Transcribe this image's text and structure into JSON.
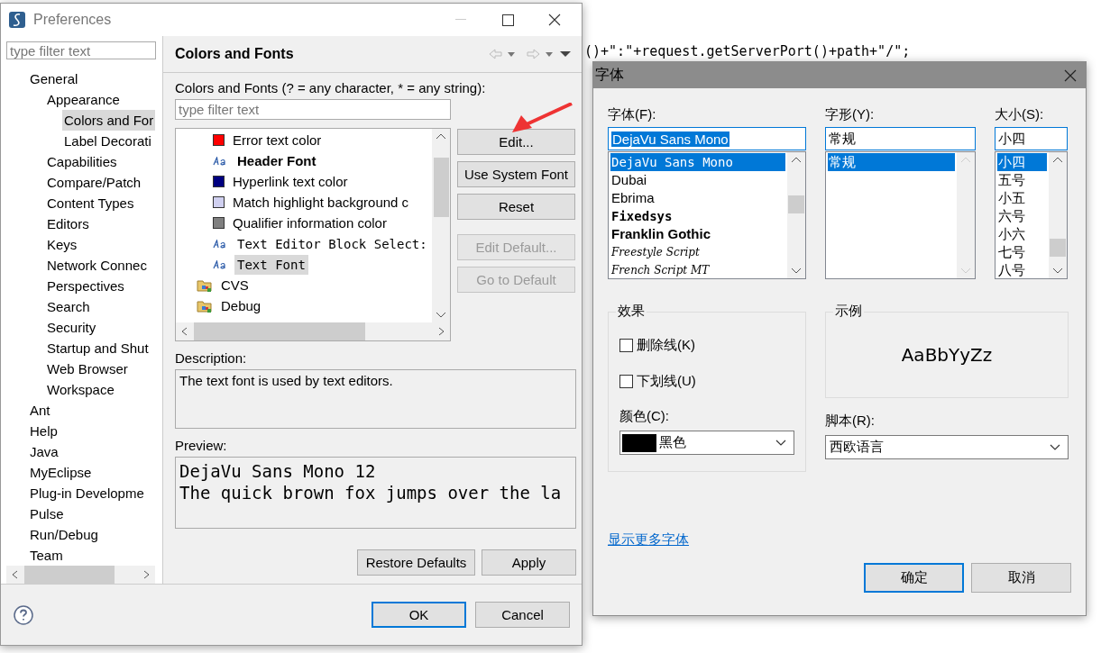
{
  "background_editor": {
    "code_line": "()+\":\"+request.getServerPort()+path+\"/\";"
  },
  "preferences": {
    "title": "Preferences",
    "filter_placeholder": "type filter text",
    "nav": [
      {
        "label": "General",
        "selected": false,
        "children": [
          {
            "label": "Appearance",
            "selected": false,
            "children": [
              {
                "label": "Colors and For",
                "selected": true
              },
              {
                "label": "Label Decorati",
                "selected": false
              }
            ]
          },
          {
            "label": "Capabilities",
            "selected": false
          },
          {
            "label": "Compare/Patch",
            "selected": false
          },
          {
            "label": "Content Types",
            "selected": false
          },
          {
            "label": "Editors",
            "selected": false
          },
          {
            "label": "Keys",
            "selected": false
          },
          {
            "label": "Network Connec",
            "selected": false
          },
          {
            "label": "Perspectives",
            "selected": false
          },
          {
            "label": "Search",
            "selected": false
          },
          {
            "label": "Security",
            "selected": false
          },
          {
            "label": "Startup and Shut",
            "selected": false
          },
          {
            "label": "Web Browser",
            "selected": false
          },
          {
            "label": "Workspace",
            "selected": false
          }
        ]
      },
      {
        "label": "Ant",
        "selected": false
      },
      {
        "label": "Help",
        "selected": false
      },
      {
        "label": "Java",
        "selected": false
      },
      {
        "label": "MyEclipse",
        "selected": false
      },
      {
        "label": "Plug-in Developme",
        "selected": false
      },
      {
        "label": "Pulse",
        "selected": false
      },
      {
        "label": "Run/Debug",
        "selected": false
      },
      {
        "label": "Team",
        "selected": false
      }
    ],
    "page": {
      "title": "Colors and Fonts",
      "filter_label": "Colors and Fonts (? = any character, * = any string):",
      "filter_placeholder": "type filter text",
      "items": [
        {
          "kind": "color",
          "label": "Error text color",
          "color": "#ff0000",
          "selected": false
        },
        {
          "kind": "bold-font",
          "label": "Header Font",
          "selected": false
        },
        {
          "kind": "color",
          "label": "Hyperlink text color",
          "color": "#000080",
          "selected": false
        },
        {
          "kind": "color",
          "label": "Match highlight background c",
          "color": "#d0d0f0",
          "selected": false
        },
        {
          "kind": "color",
          "label": "Qualifier information color",
          "color": "#808080",
          "selected": false
        },
        {
          "kind": "mono-font",
          "label": "Text Editor Block Select:",
          "selected": false
        },
        {
          "kind": "mono-font",
          "label": "Text Font",
          "selected": true
        },
        {
          "kind": "folder",
          "label": "CVS",
          "selected": false
        },
        {
          "kind": "folder",
          "label": "Debug",
          "selected": false
        }
      ],
      "buttons": [
        {
          "label": "Edit...",
          "disabled": false
        },
        {
          "label": "Use System Font",
          "disabled": false
        },
        {
          "label": "Reset",
          "disabled": false
        },
        {
          "label": "Edit Default...",
          "disabled": true
        },
        {
          "label": "Go to Default",
          "disabled": true
        }
      ],
      "description_label": "Description:",
      "description": "The text font is used by text editors.",
      "preview_label": "Preview:",
      "preview_lines": [
        "DejaVu Sans Mono 12",
        "The quick brown fox jumps over the la"
      ],
      "restore_button": "Restore Defaults",
      "apply_button": "Apply"
    },
    "ok_button": "OK",
    "cancel_button": "Cancel"
  },
  "font_dialog": {
    "title": "字体",
    "font_label": "字体(F):",
    "font_value": "DejaVu Sans Mono",
    "fonts": [
      {
        "label": "DejaVu Sans Mono",
        "kind": "mono",
        "selected": true
      },
      {
        "label": "Dubai",
        "kind": "regular",
        "selected": false
      },
      {
        "label": "Ebrima",
        "kind": "regular",
        "selected": false
      },
      {
        "label": "Fixedsys",
        "kind": "mono-bold",
        "selected": false
      },
      {
        "label": "Franklin Gothic",
        "kind": "bold",
        "selected": false
      },
      {
        "label": "Freestyle Script",
        "kind": "script",
        "selected": false
      },
      {
        "label": "French Script MT",
        "kind": "script",
        "selected": false
      }
    ],
    "style_label": "字形(Y):",
    "style_value": "常规",
    "styles": [
      {
        "label": "常规",
        "selected": true
      }
    ],
    "size_label": "大小(S):",
    "size_value": "小四",
    "sizes": [
      {
        "label": "小四",
        "selected": true
      },
      {
        "label": "五号",
        "selected": false
      },
      {
        "label": "小五",
        "selected": false
      },
      {
        "label": "六号",
        "selected": false
      },
      {
        "label": "小六",
        "selected": false
      },
      {
        "label": "七号",
        "selected": false
      },
      {
        "label": "八号",
        "selected": false
      }
    ],
    "effects_label": "效果",
    "effects": [
      {
        "label": "删除线(K)",
        "checked": false
      },
      {
        "label": "下划线(U)",
        "checked": false
      }
    ],
    "color_label": "颜色(C):",
    "color_choice": {
      "label": "黑色",
      "color": "#000000"
    },
    "sample_label": "示例",
    "sample_text": "AaBbYyZz",
    "script_label": "脚本(R):",
    "script_value": "西欧语言",
    "more_fonts_link": "显示更多字体",
    "ok_button": "确定",
    "cancel_button": "取消"
  }
}
